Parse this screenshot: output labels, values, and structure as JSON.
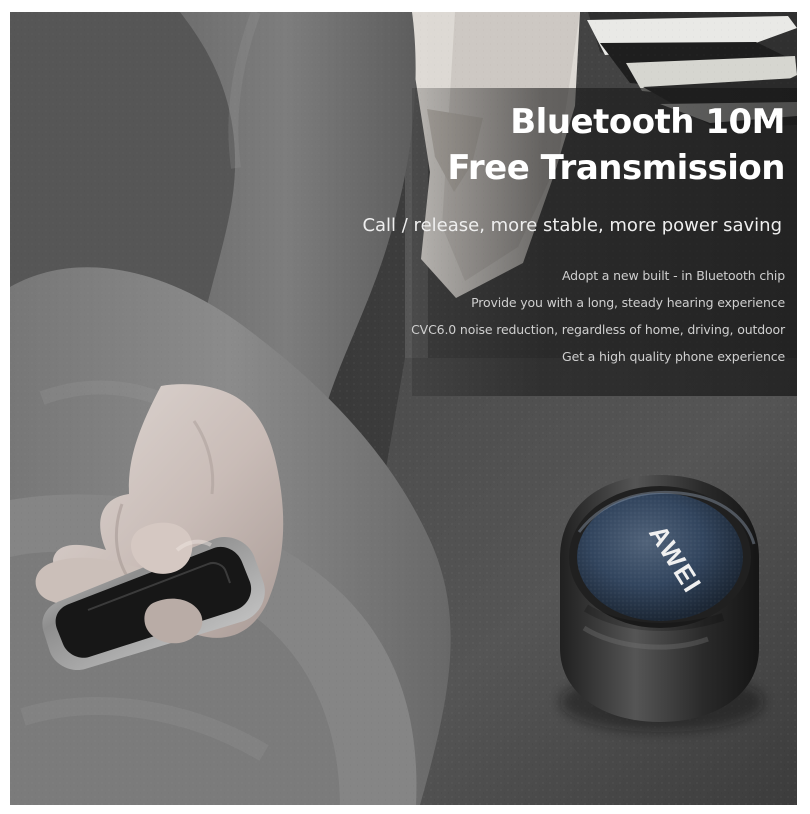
{
  "ad": {
    "headline": [
      "Bluetooth 10M",
      "Free Transmission"
    ],
    "tagline": "Call / release, more stable, more power saving",
    "features": [
      "Adopt a new built - in Bluetooth chip",
      "Provide you with a long, steady hearing experience",
      "CVC6.0 noise reduction, regardless of home, driving, outdoor",
      "Get a high quality phone experience"
    ]
  },
  "speaker": {
    "brand_logo": "AWEI"
  },
  "colors": {
    "headline_text": "#ffffff",
    "body_text": "#cfcfcf",
    "speaker_grille": "#33465f"
  }
}
